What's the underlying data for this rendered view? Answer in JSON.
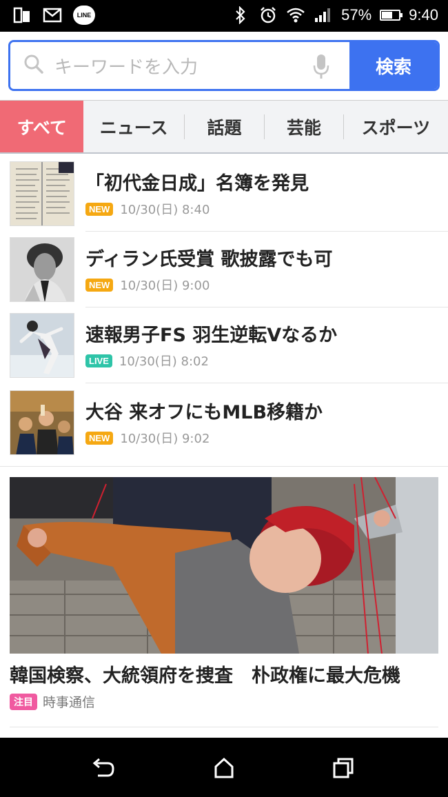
{
  "status": {
    "battery": "57%",
    "battery_level": 0.57,
    "time": "9:40",
    "line_label": "LINE"
  },
  "search": {
    "placeholder": "キーワードを入力",
    "button_label": "検索"
  },
  "tabs": [
    {
      "label": "すべて",
      "active": true
    },
    {
      "label": "ニュース"
    },
    {
      "label": "話題"
    },
    {
      "label": "芸能"
    },
    {
      "label": "スポーツ"
    }
  ],
  "news": [
    {
      "title": "「初代金日成」名簿を発見",
      "badge": "NEW",
      "date": "10/30(日) 8:40",
      "thumb_icon": "document-photo"
    },
    {
      "title": "ディラン氏受賞 歌披露でも可",
      "badge": "NEW",
      "date": "10/30(日) 9:00",
      "thumb_icon": "portrait-photo"
    },
    {
      "title": "速報男子FS 羽生逆転Vなるか",
      "badge": "LIVE",
      "date": "10/30(日) 8:02",
      "thumb_icon": "skater-photo"
    },
    {
      "title": "大谷 来オフにもMLB移籍か",
      "badge": "NEW",
      "date": "10/30(日) 9:02",
      "thumb_icon": "baseball-photo"
    }
  ],
  "feature": {
    "title": "韓国検察、大統領府を捜査　朴政権に最大危機",
    "badge": "注目",
    "source": "時事通信"
  },
  "colors": {
    "accent_blue": "#3d72f0",
    "tab_active": "#f06a75",
    "badge_new": "#f5a812",
    "badge_live": "#2ec4a8",
    "badge_hot": "#f05aa0"
  }
}
